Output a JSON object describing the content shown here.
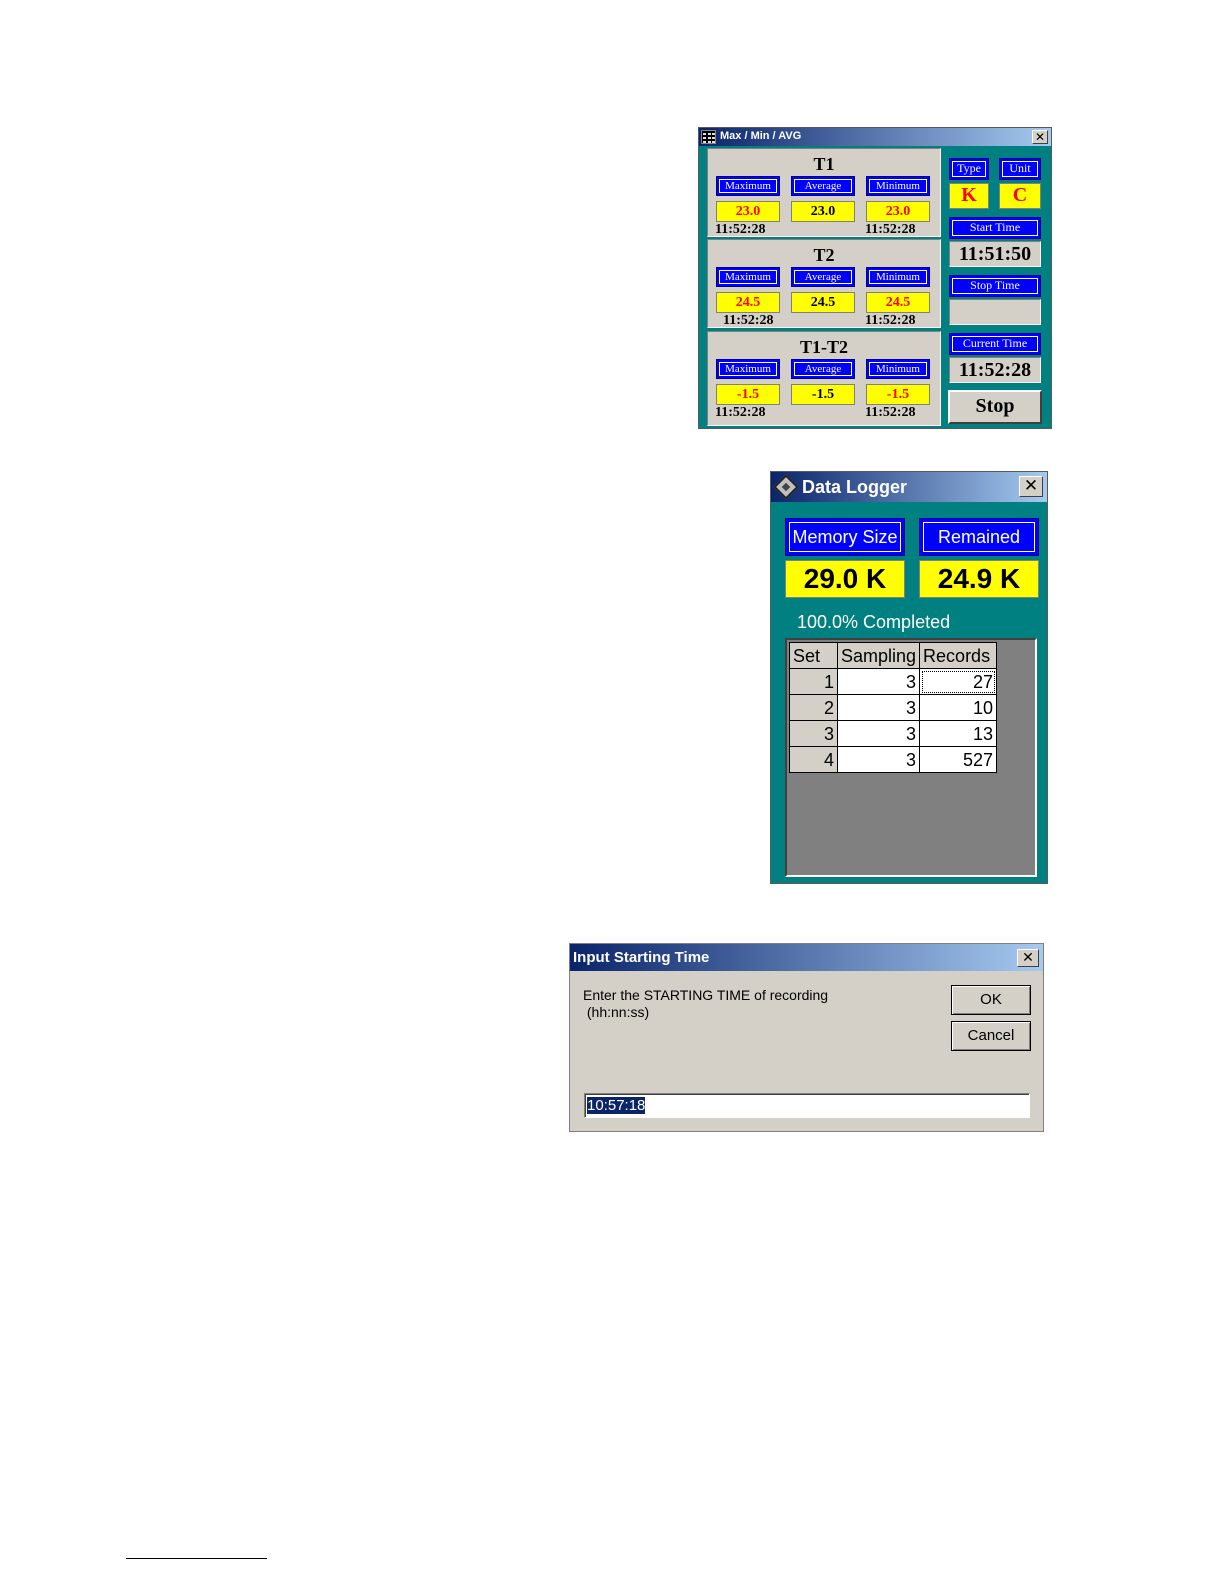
{
  "maxmin_window": {
    "title": "Max / Min / AVG",
    "close_glyph": "✕",
    "icon": "max-min-app-icon",
    "labels": {
      "maximum": "Maximum",
      "average": "Average",
      "minimum": "Minimum"
    },
    "groups": [
      {
        "name": "T1",
        "maximum": "23.0",
        "average": "23.0",
        "minimum": "23.0",
        "max_time": "11:52:28",
        "min_time": "11:52:28"
      },
      {
        "name": "T2",
        "maximum": "24.5",
        "average": "24.5",
        "minimum": "24.5",
        "max_time": "11:52:28",
        "min_time": "11:52:28"
      },
      {
        "name": "T1-T2",
        "maximum": "-1.5",
        "average": "-1.5",
        "minimum": "-1.5",
        "max_time": "11:52:28",
        "min_time": "11:52:28"
      }
    ],
    "type_label": "Type",
    "type_value": "K",
    "unit_label": "Unit",
    "unit_value": "C",
    "start_time_label": "Start Time",
    "start_time": "11:51:50",
    "stop_time_label": "Stop Time",
    "stop_time": "",
    "current_time_label": "Current Time",
    "current_time": "11:52:28",
    "stop_button": "Stop"
  },
  "logger_window": {
    "title": "Data Logger",
    "close_glyph": "✕",
    "icon": "data-logger-app-icon",
    "memory_size_label": "Memory Size",
    "memory_size": "29.0 K",
    "remained_label": "Remained",
    "remained": "24.9 K",
    "progress_text": "100.0% Completed",
    "progress_fraction": 1.0,
    "columns": [
      "Set",
      "Sampling",
      "Records"
    ],
    "rows": [
      {
        "set": "1",
        "sampling": "3",
        "records": "27"
      },
      {
        "set": "2",
        "sampling": "3",
        "records": "10"
      },
      {
        "set": "3",
        "sampling": "3",
        "records": "13"
      },
      {
        "set": "4",
        "sampling": "3",
        "records": "527"
      }
    ]
  },
  "input_dialog": {
    "title": "Input Starting Time",
    "close_glyph": "✕",
    "prompt_line1": "Enter the STARTING TIME of recording",
    "prompt_line2": " (hh:nn:ss)",
    "ok_label": "OK",
    "cancel_label": "Cancel",
    "input_value": "10:57:18"
  },
  "colors": {
    "window_bg": "#008080",
    "label_blue": "#0000ff",
    "value_yellow": "#ffff00",
    "value_red": "#ff0000",
    "face": "#d4d0c8"
  }
}
